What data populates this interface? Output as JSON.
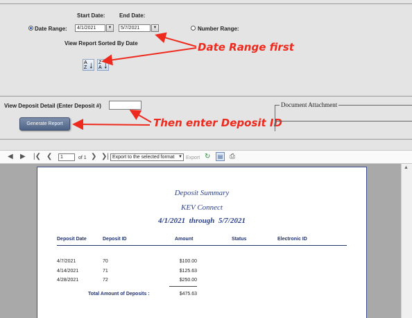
{
  "filters": {
    "start_date_label": "Start Date:",
    "end_date_label": "End Date:",
    "date_range_label": "Date Range:",
    "start_date_value": "4/1/2021",
    "end_date_value": "5/7/2021",
    "number_range_label": "Number Range:",
    "sort_label": "View Report Sorted By Date",
    "date_range_selected": true
  },
  "deposit": {
    "label": "View Deposit Detail (Enter Deposit #)",
    "value": "",
    "generate_label": "Generate Report",
    "attachment_label": "Document Attachment"
  },
  "annotations": {
    "first": "Date Range first",
    "second": "Then enter Deposit ID",
    "color": "#ee2a1e"
  },
  "toolbar": {
    "page_value": "1",
    "page_of": "of 1",
    "export_option": "Export to the selected format",
    "export_label": "Export"
  },
  "report": {
    "title": "Deposit Summary",
    "company": "KEV Connect",
    "date_range": "4/1/2021  through  5/7/2021",
    "columns": [
      "Deposit Date",
      "Deposit ID",
      "Amount",
      "Status",
      "Electronic ID"
    ],
    "rows": [
      {
        "date": "4/7/2021",
        "id": "70",
        "amount": "$100.00"
      },
      {
        "date": "4/14/2021",
        "id": "71",
        "amount": "$125.63"
      },
      {
        "date": "4/28/2021",
        "id": "72",
        "amount": "$250.00"
      }
    ],
    "total_label": "Total Amount of Deposits :",
    "total_value": "$475.63"
  },
  "colors": {
    "report_title": "#2b3f8a",
    "button": "#5a6e91"
  }
}
